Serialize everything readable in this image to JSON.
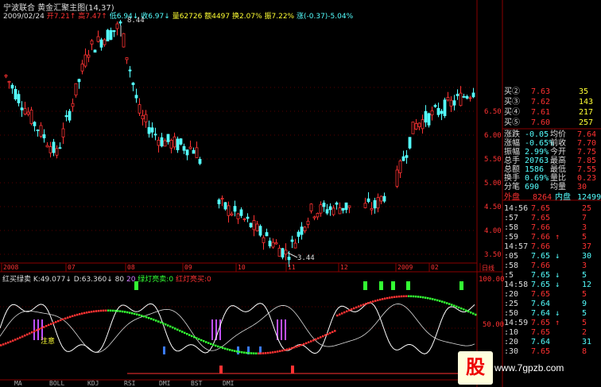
{
  "header": {
    "line1": "宁波联合  黄金汇聚主图(14,37)",
    "line2_date": "2009/02/24",
    "open_label": "开",
    "open_val": "7.21",
    "high_label": "高",
    "high_val": "7.47",
    "low_label": "低",
    "low_val": "6.94",
    "close_label": "收",
    "close_val": "6.97",
    "vol_label": "量",
    "vol_val": "62726",
    "amt_label": "额",
    "amt_val": "4497",
    "turn_label": "换",
    "turn_val": "2.07%",
    "amp_label": "振",
    "amp_val": "7.22%",
    "chg_label": "涨",
    "chg_val": "(-0.37)-5.04%"
  },
  "price_chart": {
    "max_label": "8.44",
    "min_label": "3.44",
    "y_ticks": [
      "6.50",
      "6.00",
      "5.50",
      "5.00",
      "4.50",
      "4.00",
      "3.50"
    ],
    "x_labels": [
      "2008",
      "07",
      "08",
      "09",
      "10",
      "11",
      "12",
      "2009",
      "02",
      "日线"
    ],
    "up_color": "#ff3232",
    "down_color": "#54ffff"
  },
  "indicator": {
    "title": "红买绿卖",
    "k_label": "K:",
    "k_val": "49.077",
    "d_label": "D:",
    "d_val": "63.360",
    "j_val": "80",
    "j2_val": "20",
    "green_text": "绿灯亮卖:0",
    "red_text": "红灯亮买:0",
    "y_top": "100.00",
    "y_mid": "50.00",
    "note": "注意"
  },
  "bottom_tabs": [
    "MA",
    "BOLL",
    "KDJ",
    "RSI",
    "DMI",
    "BST",
    "DMI"
  ],
  "quote_panel": {
    "bids": [
      {
        "label": "买②",
        "price": "7.63",
        "vol": "35"
      },
      {
        "label": "买③",
        "price": "7.62",
        "vol": "143"
      },
      {
        "label": "买④",
        "price": "7.61",
        "vol": "217"
      },
      {
        "label": "买⑤",
        "price": "7.60",
        "vol": "257"
      }
    ],
    "stats": [
      {
        "l1": "涨跌",
        "v1": "-0.05",
        "l2": "均价",
        "v2": "7.64"
      },
      {
        "l1": "涨幅",
        "v1": "-0.65%",
        "l2": "前收",
        "v2": "7.70"
      },
      {
        "l1": "振幅",
        "v1": "2.99%",
        "l2": "今开",
        "v2": "7.75"
      },
      {
        "l1": "总手",
        "v1": "20763",
        "l2": "最高",
        "v2": "7.85"
      },
      {
        "l1": "总额",
        "v1": "1586",
        "l2": "最低",
        "v2": "7.55"
      },
      {
        "l1": "换手",
        "v1": "0.69%",
        "l2": "量比",
        "v2": "0.23"
      },
      {
        "l1": "分笔",
        "v1": "690",
        "l2": "均量",
        "v2": "30"
      }
    ],
    "outer_label": "外盘",
    "outer_val": "8264",
    "inner_label": "内盘",
    "inner_val": "12499",
    "ticks": [
      {
        "t": "14:56",
        "p": "7.65",
        "v": "25",
        "c": "#ff3232"
      },
      {
        "t": ":57",
        "p": "7.65",
        "v": "7",
        "c": "#ff3232"
      },
      {
        "t": ":58",
        "p": "7.66",
        "v": "3",
        "c": "#ff3232"
      },
      {
        "t": ":59",
        "p": "7.66 ↑",
        "v": "5",
        "c": "#ff3232"
      },
      {
        "t": "14:57",
        "p": "7.66",
        "v": "37",
        "c": "#ff3232"
      },
      {
        "t": ":05",
        "p": "7.65 ↓",
        "v": "30",
        "c": "#54ffff"
      },
      {
        "t": ":58",
        "p": "7.66",
        "v": "3",
        "c": "#ff3232"
      },
      {
        "t": ":5",
        "p": "7.65 ↓",
        "v": "5",
        "c": "#54ffff"
      },
      {
        "t": "14:58",
        "p": "7.65 ↓",
        "v": "12",
        "c": "#54ffff"
      },
      {
        "t": ":20",
        "p": "7.65",
        "v": "5",
        "c": "#ff3232"
      },
      {
        "t": ":25",
        "p": "7.64",
        "v": "9",
        "c": "#54ffff"
      },
      {
        "t": ":50",
        "p": "7.64 ↓",
        "v": "5",
        "c": "#54ffff"
      },
      {
        "t": "14:59",
        "p": "7.65 ↑",
        "v": "5",
        "c": "#ff3232"
      },
      {
        "t": ":10",
        "p": "7.65",
        "v": "2",
        "c": "#ff3232"
      },
      {
        "t": ":20",
        "p": "7.64",
        "v": "31",
        "c": "#54ffff"
      },
      {
        "t": ":30",
        "p": "7.65",
        "v": "8",
        "c": "#ff3232"
      }
    ]
  },
  "watermark": {
    "site": "www.7gpzb.com",
    "logo": "股"
  }
}
